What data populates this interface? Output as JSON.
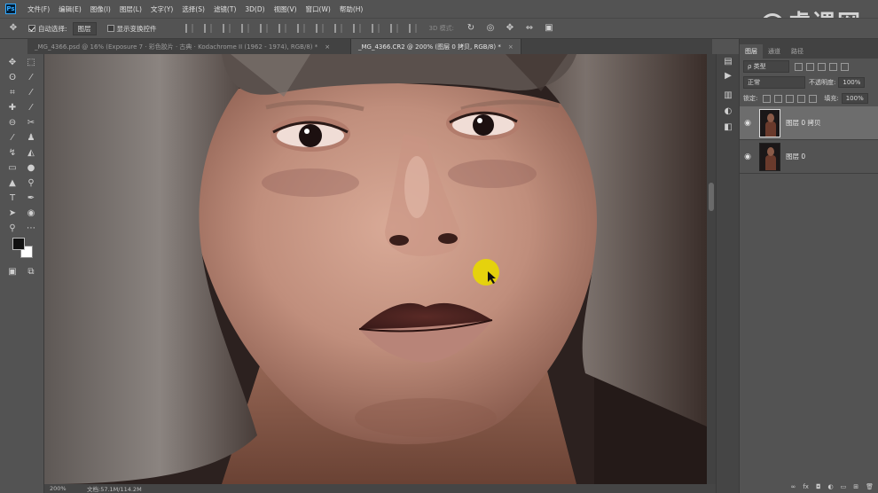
{
  "app": {
    "logo": "Ps"
  },
  "menu": [
    "文件(F)",
    "编辑(E)",
    "图像(I)",
    "图层(L)",
    "文字(Y)",
    "选择(S)",
    "滤镜(T)",
    "3D(D)",
    "视图(V)",
    "窗口(W)",
    "帮助(H)"
  ],
  "watermark": {
    "text": "虎课网"
  },
  "options": {
    "auto_select_label": "自动选择:",
    "auto_select_value": "图层",
    "show_transform_label": "显示变换控件",
    "mode_3d": "3D 模式:"
  },
  "tabs": [
    {
      "label": "_MG_4366.psd @ 16% (Exposure 7 · 彩色胶片 · 古典 · Kodachrome II (1962 - 1974), RGB/8) *",
      "close": "×",
      "active": false
    },
    {
      "label": "_MG_4366.CR2 @ 200% (图层 0 拷贝, RGB/8) *",
      "close": "×",
      "active": true
    }
  ],
  "status": {
    "zoom": "200%",
    "doc": "文档:57.1M/114.2M"
  },
  "layers_panel": {
    "tabs": [
      "图层",
      "通道",
      "路径"
    ],
    "filter_label": "ρ 类型",
    "blend_mode": "正常",
    "opacity_label": "不透明度:",
    "opacity_value": "100%",
    "lock_label": "锁定:",
    "fill_label": "填充:",
    "fill_value": "100%",
    "layers": [
      {
        "name": "图层 0 拷贝",
        "selected": true
      },
      {
        "name": "图层 0",
        "selected": false
      }
    ],
    "footer_icons": [
      "link-icon",
      "fx-icon",
      "mask-icon",
      "adjustment-icon",
      "group-icon",
      "new-layer-icon",
      "trash-icon"
    ],
    "footer_glyphs": [
      "∞",
      "fx",
      "◘",
      "◐",
      "▭",
      "⊞",
      "🗑"
    ]
  },
  "colors": {
    "accent": "#31a8ff",
    "cursor_highlight": "#e8d800"
  }
}
